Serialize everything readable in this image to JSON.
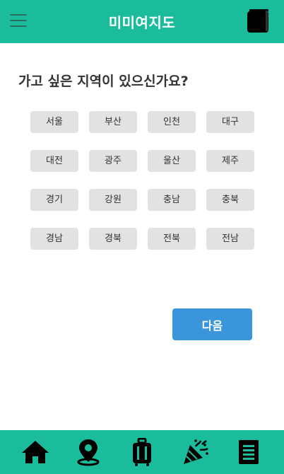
{
  "header": {
    "title": "미미여지도",
    "menu_icon": "hamburger-menu-icon",
    "book_icon": "book-icon"
  },
  "question": "가고 싶은 지역이 있으신가요?",
  "regions": [
    "서울",
    "부산",
    "인천",
    "대구",
    "대전",
    "광주",
    "울산",
    "제주",
    "경기",
    "강원",
    "충남",
    "충북",
    "경남",
    "경북",
    "전북",
    "전남"
  ],
  "next_button": "다음",
  "bottom_nav": [
    "home-icon",
    "map-pin-icon",
    "suitcase-icon",
    "party-popper-icon",
    "document-list-icon"
  ],
  "colors": {
    "primary": "#1bbc9b",
    "button": "#3b95db",
    "chip": "#e2e2e2"
  }
}
